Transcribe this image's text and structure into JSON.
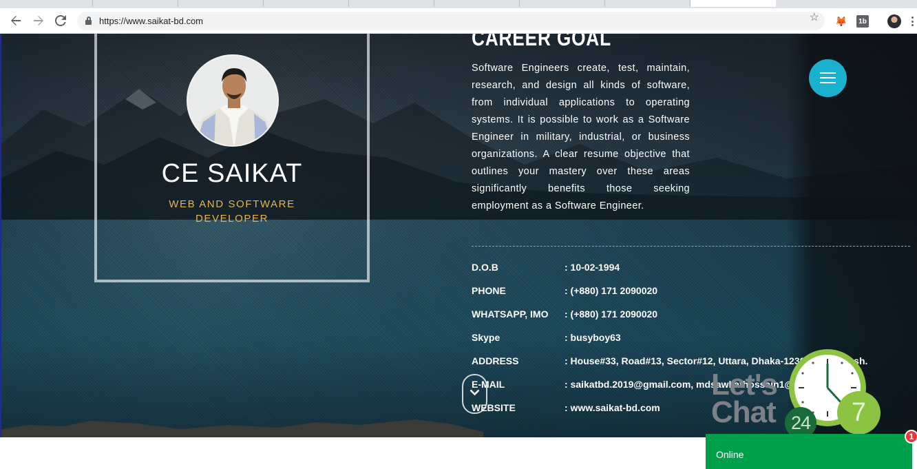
{
  "browser": {
    "url": "https://www.saikat-bd.com",
    "icons": {
      "back": "arrow-left-icon",
      "forward": "arrow-right-icon",
      "reload": "reload-icon",
      "secure": "lock-icon",
      "bookmark": "star-icon",
      "extension_1": "metamask-fox-icon",
      "extension_2": "1b",
      "profile": "avatar-icon",
      "menu": "kebab-menu-icon"
    }
  },
  "profile": {
    "name": "CE SAIKAT",
    "role_line1": "WEB AND SOFTWARE",
    "role_line2": "DEVELOPER"
  },
  "career": {
    "title": "CAREER GOAL",
    "text": "Software Engineers create, test, maintain, research, and design all kinds of software, from individual applications to operating systems. It is possible to work as a Software Engineer in military, industrial, or business organizations. A clear resume objective that outlines your mastery over these areas significantly benefits those seeking employment as a Software Engineer."
  },
  "info": [
    {
      "label": "D.O.B",
      "value": ": 10-02-1994"
    },
    {
      "label": "PHONE",
      "value": ": (+880) 171 2090020"
    },
    {
      "label": "WHATSAPP, IMO",
      "value": ": (+880) 171 2090020"
    },
    {
      "label": "Skype",
      "value": ": busyboy63"
    },
    {
      "label": "ADDRESS",
      "value": ": House#33, Road#13, Sector#12, Uttara, Dhaka-1230, Bangladesh."
    },
    {
      "label": "E-MAIL",
      "value": ":  saikatbd.2019@gmail.com, mdsawkathossain1@gmail.com"
    },
    {
      "label": "WEBSITE",
      "value": ": www.saikat-bd.com"
    }
  ],
  "chat": {
    "line1": "Let's",
    "line2": "Chat",
    "hours": "24",
    "days": "7",
    "status": "Online",
    "notification_count": "1"
  },
  "colors": {
    "accent_cyan": "#1ab1cf",
    "role_gold": "#e8b54a",
    "chat_green": "#00a04a",
    "badge_red": "#e5383b"
  }
}
